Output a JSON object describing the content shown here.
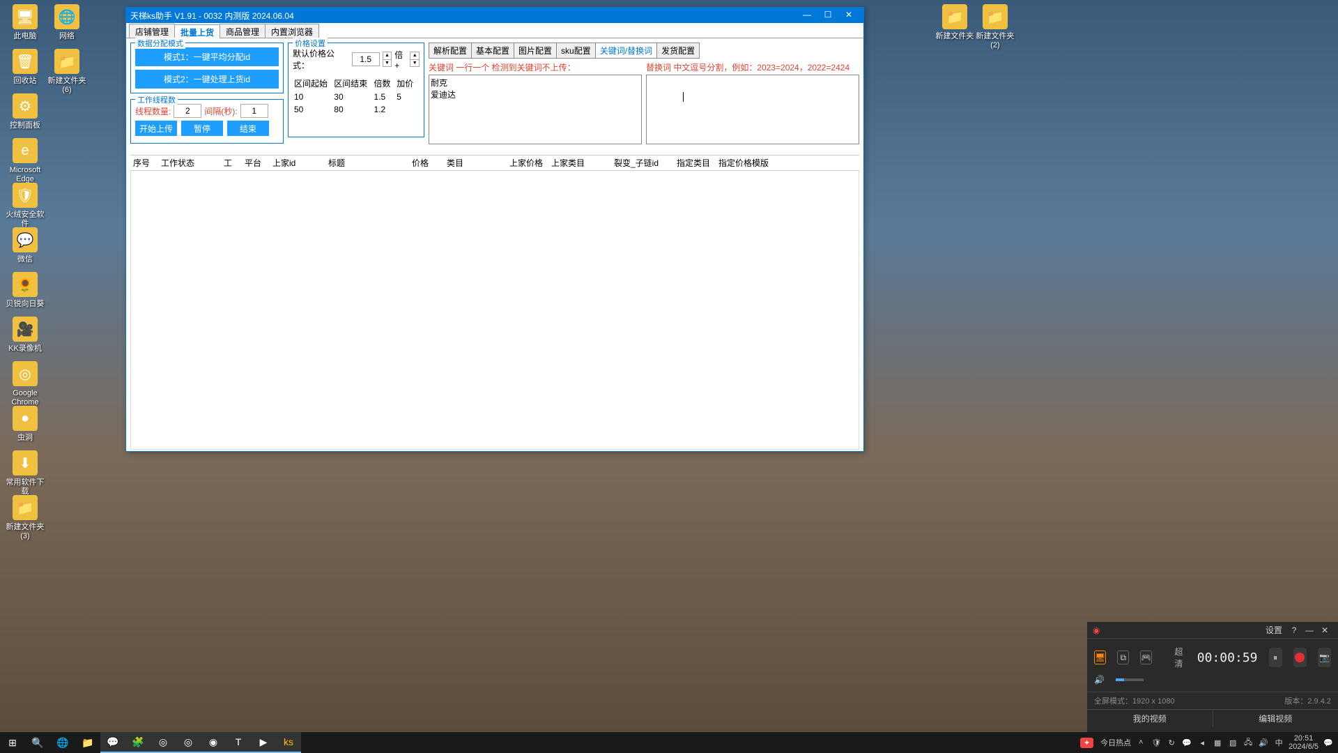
{
  "desktop": {
    "icons_left": [
      {
        "label": "此电脑",
        "glyph": "🖥"
      },
      {
        "label": "回收站",
        "glyph": "🗑"
      },
      {
        "label": "控制面板",
        "glyph": "⚙"
      },
      {
        "label": "Microsoft Edge",
        "glyph": "e"
      },
      {
        "label": "火绒安全软件",
        "glyph": "🛡"
      },
      {
        "label": "微信",
        "glyph": "💬"
      },
      {
        "label": "贝锐向日葵",
        "glyph": "🌻"
      },
      {
        "label": "KK录像机",
        "glyph": "🎥"
      },
      {
        "label": "Google Chrome",
        "glyph": "◎"
      },
      {
        "label": "虫洞",
        "glyph": "●"
      },
      {
        "label": "常用软件下载",
        "glyph": "⬇"
      },
      {
        "label": "新建文件夹 (3)",
        "glyph": "📁"
      }
    ],
    "icons_left2": [
      {
        "label": "网络",
        "glyph": "🌐"
      },
      {
        "label": "新建文件夹 (6)",
        "glyph": "📁"
      }
    ],
    "icons_right": [
      {
        "label": "新建文件夹",
        "glyph": "📁"
      },
      {
        "label": "新建文件夹 (2)",
        "glyph": "📁"
      }
    ]
  },
  "app": {
    "title": "天梯ks助手 V1.91 - 0032 内测版 2024.06.04",
    "main_tabs": [
      "店铺管理",
      "批量上货",
      "商品管理",
      "内置浏览器"
    ],
    "main_tab_active": 1,
    "data_mode": {
      "legend": "数据分配模式",
      "btn1": "模式1：一键平均分配id",
      "btn2": "模式2：一键处理上货id"
    },
    "worker": {
      "legend": "工作线程数",
      "thread_label": "线程数量:",
      "thread_value": "2",
      "interval_label": "间隔(秒):",
      "interval_value": "1",
      "start": "开始上传",
      "pause": "暂停",
      "stop": "结束"
    },
    "price": {
      "legend": "价格设置",
      "formula_label": "默认价格公式：",
      "formula_value": "1.5",
      "formula_suffix": "倍+",
      "headers": [
        "区间起始",
        "区间结束",
        "倍数",
        "加价"
      ],
      "rows": [
        [
          "10",
          "30",
          "1.5",
          "5"
        ],
        [
          "50",
          "80",
          "1.2",
          ""
        ]
      ]
    },
    "sub_tabs": [
      "解析配置",
      "基本配置",
      "图片配置",
      "sku配置",
      "关键词/替换词",
      "发货配置"
    ],
    "sub_tab_active": 4,
    "keywords": {
      "label": "关键词 一行一个 检测到关键词不上传：",
      "value": "耐克\n爱迪达"
    },
    "replace": {
      "label": "替换词 中文逗号分割，例如：2023=2024，2022=2424",
      "value": ""
    },
    "columns": [
      "序号",
      "工作状态",
      "工",
      "平台",
      "上家id",
      "标题",
      "价格",
      "类目",
      "上家价格",
      "上家类目",
      "裂变_子链id",
      "指定类目",
      "指定价格模版"
    ]
  },
  "recorder": {
    "title_icon": "●",
    "settings": "设置",
    "quality": "超清",
    "time": "00:00:59",
    "fullscreen_label": "全屏模式：",
    "resolution": "1920 x 1080",
    "version_label": "版本：",
    "version": "2.9.4.2",
    "tab1": "我的视频",
    "tab2": "编辑视频"
  },
  "taskbar": {
    "hot": "今日热点",
    "ime": "中",
    "time": "20:51",
    "date": "2024/6/5"
  }
}
